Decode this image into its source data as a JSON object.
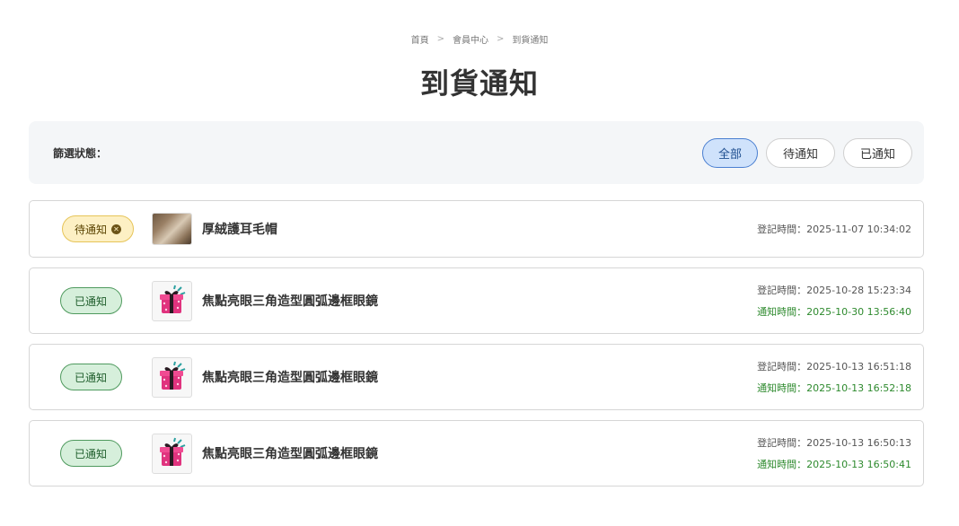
{
  "breadcrumb": {
    "items": [
      "首頁",
      "會員中心",
      "到貨通知"
    ],
    "separator": ">"
  },
  "page_title": "到貨通知",
  "filter": {
    "label": "篩選狀態：",
    "options": [
      "全部",
      "待通知",
      "已通知"
    ],
    "selected": "全部"
  },
  "colors": {
    "active_filter_bg": "#cfe2fb",
    "pending_badge_bg": "#fdf0c4",
    "notified_badge_bg": "#d6efdb",
    "notify_time_text": "#2e8a2e"
  },
  "items": [
    {
      "status": "待通知",
      "status_icon": "close-circle-icon",
      "thumbnail": "hat-photo",
      "product_name": "厚絨護耳毛帽",
      "registered": "登記時間：2025-11-07 10:34:02",
      "notified": ""
    },
    {
      "status": "已通知",
      "thumbnail": "gift-box-icon",
      "product_name": "焦點亮眼三角造型圓弧邊框眼鏡",
      "registered": "登記時間：2025-10-28 15:23:34",
      "notified": "通知時間：2025-10-30 13:56:40"
    },
    {
      "status": "已通知",
      "thumbnail": "gift-box-icon",
      "product_name": "焦點亮眼三角造型圓弧邊框眼鏡",
      "registered": "登記時間：2025-10-13 16:51:18",
      "notified": "通知時間：2025-10-13 16:52:18"
    },
    {
      "status": "已通知",
      "thumbnail": "gift-box-icon",
      "product_name": "焦點亮眼三角造型圓弧邊框眼鏡",
      "registered": "登記時間：2025-10-13 16:50:13",
      "notified": "通知時間：2025-10-13 16:50:41"
    }
  ]
}
